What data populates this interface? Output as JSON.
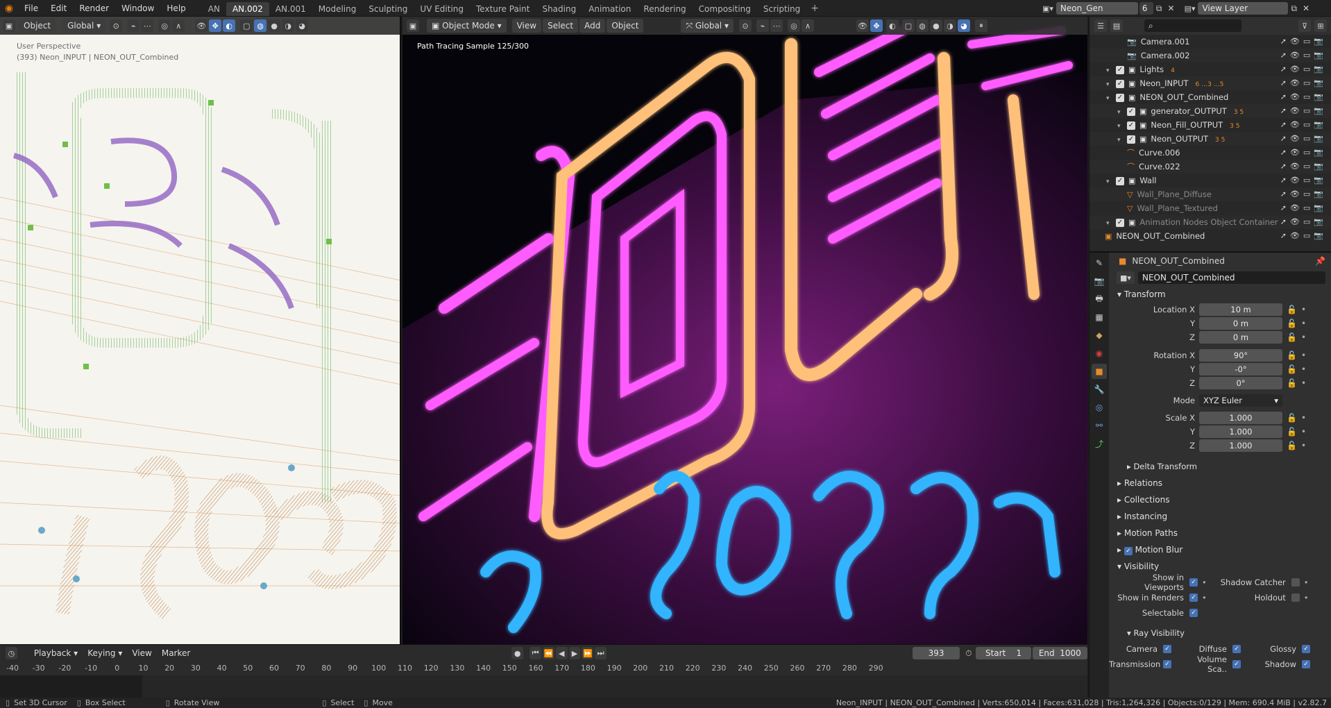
{
  "menu": {
    "file": "File",
    "edit": "Edit",
    "render": "Render",
    "window": "Window",
    "help": "Help"
  },
  "workspaces": [
    "AN",
    "AN.002",
    "AN.001",
    "Modeling",
    "Sculpting",
    "UV Editing",
    "Texture Paint",
    "Shading",
    "Animation",
    "Rendering",
    "Compositing",
    "Scripting"
  ],
  "scene": {
    "name": "Neon_Gen",
    "users": "6",
    "view_layer": "View Layer"
  },
  "left_viewport": {
    "mode": "Object",
    "orientation": "Global",
    "overlay_title": "User Perspective",
    "overlay_object": "(393) Neon_INPUT | NEON_OUT_Combined"
  },
  "right_viewport": {
    "mode": "Object Mode",
    "menu": [
      "View",
      "Select",
      "Add",
      "Object"
    ],
    "orientation": "Global",
    "render_status": "Path Tracing Sample 125/300"
  },
  "outliner": {
    "rows": [
      {
        "name": "Camera.001",
        "indent": 2,
        "type": "camera"
      },
      {
        "name": "Camera.002",
        "indent": 2,
        "type": "camera"
      },
      {
        "name": "Lights",
        "indent": 1,
        "type": "collection",
        "badge": "4"
      },
      {
        "name": "Neon_INPUT",
        "indent": 1,
        "type": "collection",
        "badge": "6 …3 …5"
      },
      {
        "name": "NEON_OUT_Combined",
        "indent": 1,
        "type": "collection"
      },
      {
        "name": "generator_OUTPUT",
        "indent": 2,
        "type": "collection",
        "badge": "3 5"
      },
      {
        "name": "Neon_Fill_OUTPUT",
        "indent": 2,
        "type": "collection",
        "badge": "3 5"
      },
      {
        "name": "Neon_OUTPUT",
        "indent": 2,
        "type": "collection",
        "badge": "3 5"
      },
      {
        "name": "Curve.006",
        "indent": 2,
        "type": "curve"
      },
      {
        "name": "Curve.022",
        "indent": 2,
        "type": "curve"
      },
      {
        "name": "Wall",
        "indent": 1,
        "type": "collection"
      },
      {
        "name": "Wall_Plane_Diffuse",
        "indent": 2,
        "type": "mesh",
        "dim": true
      },
      {
        "name": "Wall_Plane_Textured",
        "indent": 2,
        "type": "mesh",
        "dim": true
      },
      {
        "name": "Animation Nodes Object Container",
        "indent": 1,
        "type": "collection",
        "dim": true
      },
      {
        "name": "NEON_OUT_Combined",
        "indent": 0,
        "type": "object"
      }
    ]
  },
  "properties": {
    "object_name": "NEON_OUT_Combined",
    "data_name": "NEON_OUT_Combined",
    "transform": {
      "title": "Transform",
      "location_label": "Location X",
      "location": [
        "10 m",
        "0 m",
        "0 m"
      ],
      "rotation_label": "Rotation X",
      "rotation": [
        "90°",
        "-0°",
        "0°"
      ],
      "mode_label": "Mode",
      "mode": "XYZ Euler",
      "scale_label": "Scale X",
      "scale": [
        "1.000",
        "1.000",
        "1.000"
      ],
      "y": "Y",
      "z": "Z"
    },
    "sections": [
      "Delta Transform",
      "Relations",
      "Collections",
      "Instancing",
      "Motion Paths",
      "Motion Blur",
      "Visibility"
    ],
    "visibility": {
      "show_viewports": "Show in Viewports",
      "show_renders": "Show in Renders",
      "selectable": "Selectable",
      "shadow_catcher": "Shadow Catcher",
      "holdout": "Holdout"
    },
    "ray": {
      "title": "Ray Visibility",
      "camera": "Camera",
      "diffuse": "Diffuse",
      "glossy": "Glossy",
      "transmission": "Transmission",
      "volume": "Volume Sca..",
      "shadow": "Shadow"
    }
  },
  "timeline": {
    "menu": [
      "Playback",
      "Keying",
      "View",
      "Marker"
    ],
    "current_frame": "393",
    "start_label": "Start",
    "start": "1",
    "end_label": "End",
    "end": "1000",
    "ticks": [
      "-40",
      "-30",
      "-20",
      "-10",
      "0",
      "10",
      "20",
      "30",
      "40",
      "50",
      "60",
      "70",
      "80",
      "90",
      "100",
      "110",
      "120",
      "130",
      "140",
      "150",
      "160",
      "170",
      "180",
      "190",
      "200",
      "210",
      "220",
      "230",
      "240",
      "250",
      "260",
      "270",
      "280",
      "290"
    ]
  },
  "status": {
    "left1": "Set 3D Cursor",
    "left2": "Box Select",
    "left3": "Rotate View",
    "mid1": "Select",
    "mid2": "Move",
    "right": "Neon_INPUT | NEON_OUT_Combined | Verts:650,014 | Faces:631,028 | Tris:1,264,326 | Objects:0/129 | Mem: 690.4 MiB | v2.82.7"
  }
}
